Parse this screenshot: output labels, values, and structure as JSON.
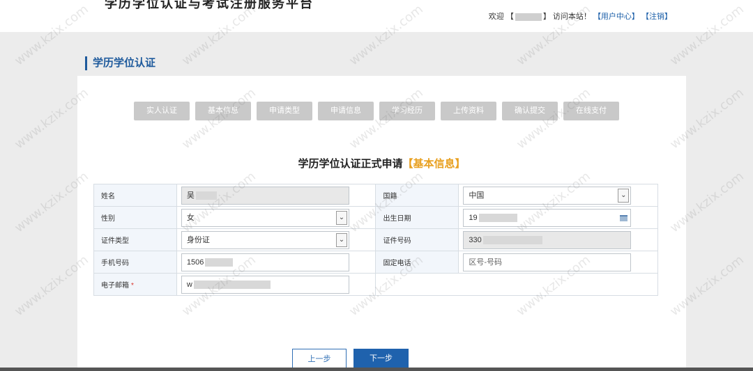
{
  "header": {
    "cut_title": "学历学位认证与考试注册服务平台",
    "welcome": "欢迎",
    "bracket_open": "【",
    "bracket_close": "】",
    "visit_text": "访问本站！",
    "user_center": "【用户中心】",
    "logout": "【注销】"
  },
  "section_title": "学历学位认证",
  "steps": [
    "实人认证",
    "基本信息",
    "申请类型",
    "申请信息",
    "学习经历",
    "上传资料",
    "确认提交",
    "在线支付"
  ],
  "form": {
    "heading": "学历学位认证正式申请",
    "heading_accent": "【基本信息】",
    "name_label": "姓名",
    "name_value": "吴",
    "nationality_label": "国籍",
    "nationality_value": "中国",
    "gender_label": "性别",
    "gender_value": "女",
    "birth_label": "出生日期",
    "birth_value": "19",
    "id_type_label": "证件类型",
    "id_type_value": "身份证",
    "id_number_label": "证件号码",
    "id_number_value": "330",
    "mobile_label": "手机号码",
    "mobile_value": "1506",
    "phone_label": "固定电话",
    "phone_placeholder": "区号-号码",
    "email_label": "电子邮箱",
    "email_required": "*",
    "email_value": "w"
  },
  "buttons": {
    "prev": "上一步",
    "next": "下一步"
  },
  "watermark": "www.kzix.com"
}
